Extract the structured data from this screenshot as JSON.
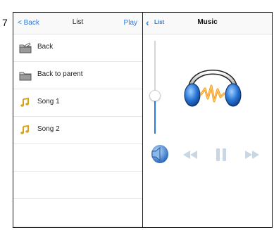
{
  "step_number": "7",
  "list_screen": {
    "nav": {
      "back_label": "< Back",
      "title": "List",
      "action_label": "Play"
    },
    "rows": [
      {
        "label": "Back",
        "icon": "folder-icon"
      },
      {
        "label": "Back to parent",
        "icon": "folder-icon"
      },
      {
        "label": "Song 1",
        "icon": "music-note-icon"
      },
      {
        "label": "Song 2",
        "icon": "music-note-icon"
      }
    ]
  },
  "music_screen": {
    "nav": {
      "back_label": "List",
      "title": "Music"
    },
    "volume_level": 0.42,
    "controls": [
      "speaker-icon",
      "rewind-icon",
      "pause-icon",
      "fast-forward-icon"
    ]
  },
  "colors": {
    "accent": "#2a7ae4",
    "note": "#d9a21b",
    "separator": "#e6e6e6"
  }
}
